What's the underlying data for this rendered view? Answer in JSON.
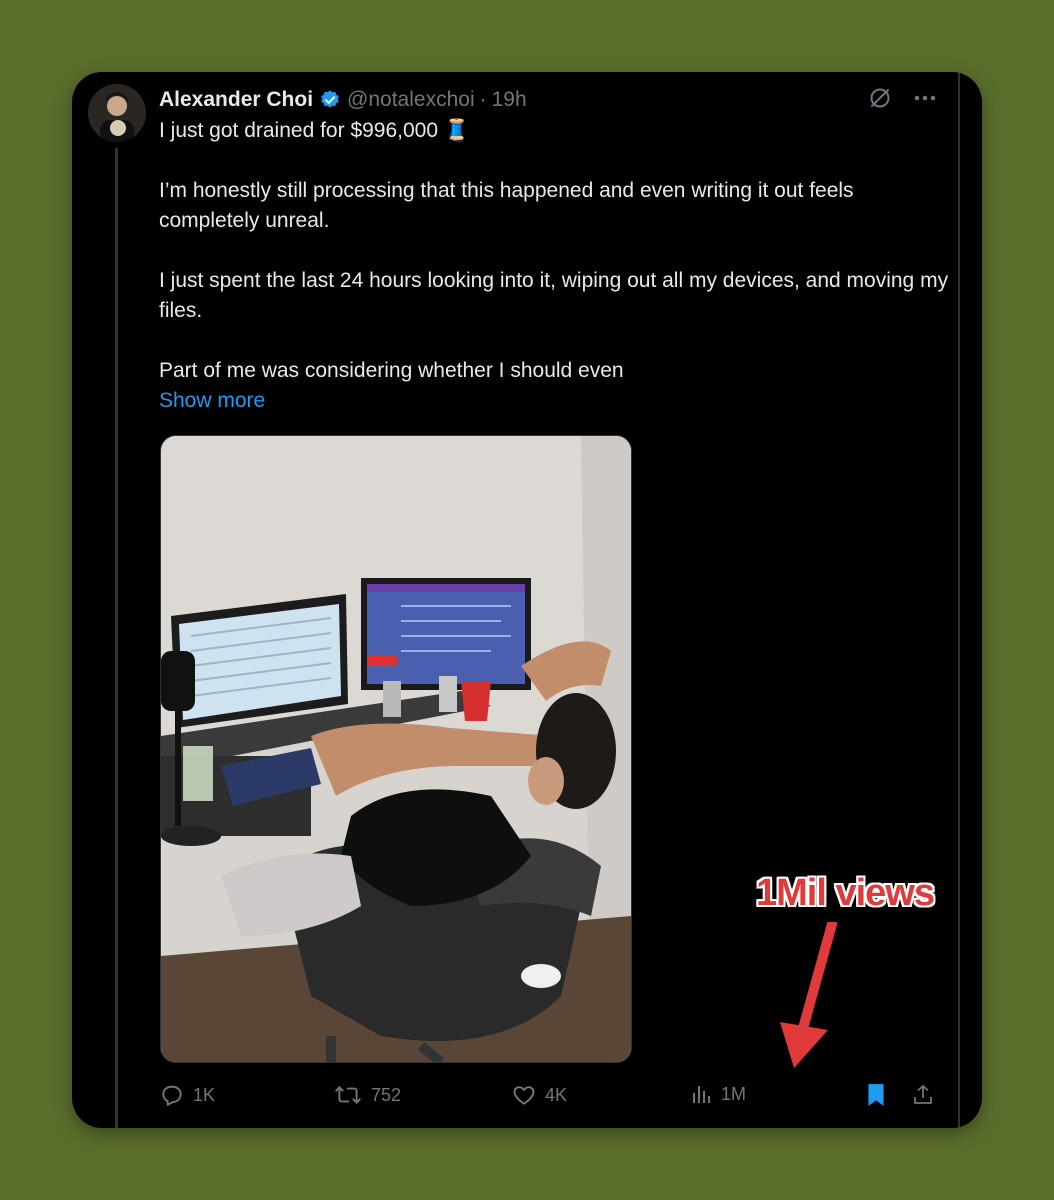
{
  "tweet": {
    "author_name": "Alexander Choi",
    "handle": "@notalexchoi",
    "separator": "·",
    "time": "19h",
    "paragraphs": [
      "I just got drained for $996,000 🧵",
      "I’m honestly still processing that this happened and even writing it out feels completely unreal.",
      "I just spent the last 24 hours looking into it, wiping out all my devices, and moving my files.",
      "Part of me was considering whether I should even"
    ],
    "show_more": "Show more"
  },
  "actions": {
    "replies": "1K",
    "reposts": "752",
    "likes": "4K",
    "views": "1M"
  },
  "annotation": {
    "label": "1Mil views",
    "color": "#e03a3a"
  },
  "colors": {
    "background": "#5a6e2c",
    "card": "#000000",
    "link": "#1d9bf0",
    "verified": "#1d9bf0",
    "bookmark_active": "#1d9bf0",
    "muted": "#71767b"
  }
}
